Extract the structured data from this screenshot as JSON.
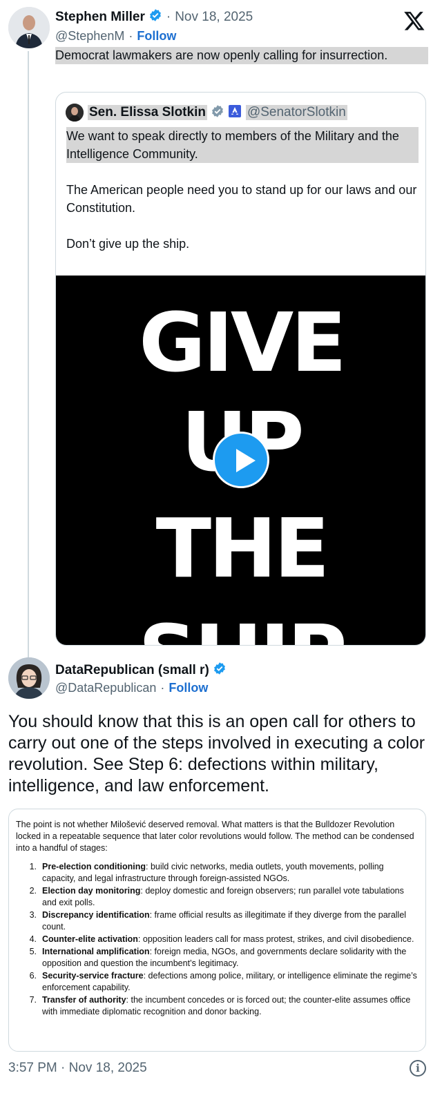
{
  "tweet1": {
    "author_name": "Stephen Miller",
    "separator": "·",
    "date": "Nov 18, 2025",
    "handle": "@StephenM",
    "follow_label": "Follow",
    "text": "Democrat lawmakers are now openly calling for insurrection."
  },
  "quote": {
    "author_name": "Sen. Elissa Slotkin",
    "handle": "@SenatorSlotkin",
    "paragraphs": [
      "We want to speak directly to members of the Military and the Intelligence Community.",
      "The American people need you to stand up for our laws and our Constitution.",
      "Don’t give up the ship."
    ],
    "video_words": [
      "GIVE",
      "UP",
      "THE",
      "SHIP"
    ]
  },
  "tweet2": {
    "author_name": "DataRepublican (small r)",
    "handle": "@DataRepublican",
    "separator": "·",
    "follow_label": "Follow",
    "text": "You should know that this is an open call for others to carry out one of the steps involved in executing a color revolution. See Step 6: defections within military, intelligence, and law enforcement."
  },
  "document": {
    "intro": "The point is not whether Milošević deserved removal. What matters is that the Bulldozer Revolution locked in a repeatable sequence that later color revolutions would follow. The method can be condensed into a handful of stages:",
    "items": [
      {
        "num": "1.",
        "term": "Pre-election conditioning",
        "desc": ": build civic networks, media outlets, youth movements, polling capacity, and legal infrastructure through foreign-assisted NGOs."
      },
      {
        "num": "2.",
        "term": "Election day monitoring",
        "desc": ": deploy domestic and foreign observers; run parallel vote tabulations and exit polls."
      },
      {
        "num": "3.",
        "term": "Discrepancy identification",
        "desc": ": frame official results as illegitimate if they diverge from the parallel count."
      },
      {
        "num": "4.",
        "term": "Counter-elite activation",
        "desc": ": opposition leaders call for mass protest, strikes, and civil disobedience."
      },
      {
        "num": "5.",
        "term": "International amplification",
        "desc": ": foreign media, NGOs, and governments declare solidarity with the opposition and question the incumbent’s legitimacy."
      },
      {
        "num": "6.",
        "term": "Security-service fracture",
        "desc": ": defections among police, military, or intelligence eliminate the regime’s enforcement capability."
      },
      {
        "num": "7.",
        "term": "Transfer of authority",
        "desc": ": the incumbent concedes or is forced out; the counter-elite assumes office with immediate diplomatic recognition and donor backing."
      }
    ]
  },
  "footer": {
    "timestamp": "3:57 PM · Nov 18, 2025",
    "info_glyph": "i"
  },
  "colors": {
    "link_blue": "#1d6fd0",
    "verified_blue": "#1d9bf0",
    "muted_text": "#536471",
    "highlight_gray": "#d6d6d6",
    "video_bg": "#000000"
  },
  "icons": [
    "x-logo-icon",
    "verified-badge-icon",
    "gov-badge-icon",
    "play-icon",
    "info-icon"
  ]
}
